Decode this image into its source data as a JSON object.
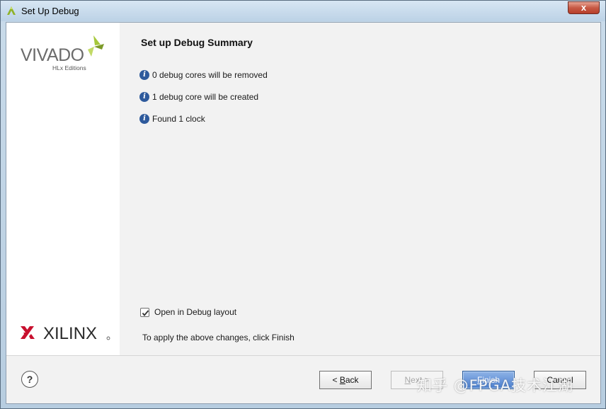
{
  "window": {
    "title": "Set Up Debug",
    "close_label": "x"
  },
  "logos": {
    "vivado_text": "VIVADO",
    "vivado_sub": "HLx Editions",
    "xilinx_text": "XILINX"
  },
  "summary": {
    "title": "Set up Debug Summary",
    "items": [
      "0 debug cores will be removed",
      "1 debug core will be created",
      "Found 1 clock"
    ]
  },
  "options": {
    "open_debug_layout_label": "Open in Debug layout",
    "open_debug_layout_checked": true
  },
  "note": "To apply the above changes, click Finish",
  "buttons": {
    "help": "?",
    "back_prefix": "< ",
    "back_mnemonic": "B",
    "back_rest": "ack",
    "next_prefix": "",
    "next_mnemonic": "N",
    "next_rest": "ext >",
    "finish_prefix": "",
    "finish_mnemonic": "F",
    "finish_rest": "inish",
    "cancel": "Cancel"
  },
  "watermark": "知乎 @FPGA技术江湖",
  "colors": {
    "vivado_accent": "#a6c83a",
    "xilinx_red": "#c8102e",
    "info_icon": "#2e5a9c",
    "default_button": "#4a7fcf"
  }
}
